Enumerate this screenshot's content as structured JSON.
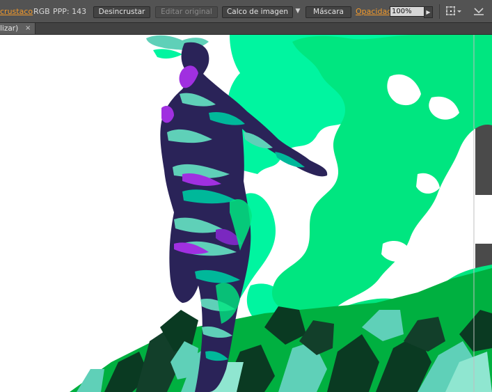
{
  "control_bar": {
    "embedded_label": "crustaco",
    "color_mode": "RGB",
    "ppi_label": "PPP: 143",
    "unembed_button": "Desincrustar",
    "edit_original_button": "Editar original",
    "image_trace_button": "Calco de imagen",
    "mask_button": "Máscara",
    "opacity_label": "Opacidad:",
    "opacity_value": "100%",
    "icons": [
      "dropdown-arrow-icon",
      "opacity-slider-arrow-icon",
      "transform-grid-icon",
      "panel-menu-icon"
    ]
  },
  "document_tab": {
    "title": "lizar)",
    "close_glyph": "×"
  },
  "colors": {
    "ui_background": "#535353",
    "link_orange": "#f39a2b",
    "artboard": "#ffffff",
    "smoke_green": "#00e680",
    "mint_green": "#00f5a0",
    "dark_navy": "#2a2358",
    "purple_accent": "#a030e0",
    "teal": "#5fd0b8",
    "forest_green": "#00b040",
    "dark_green": "#0a3a22"
  }
}
